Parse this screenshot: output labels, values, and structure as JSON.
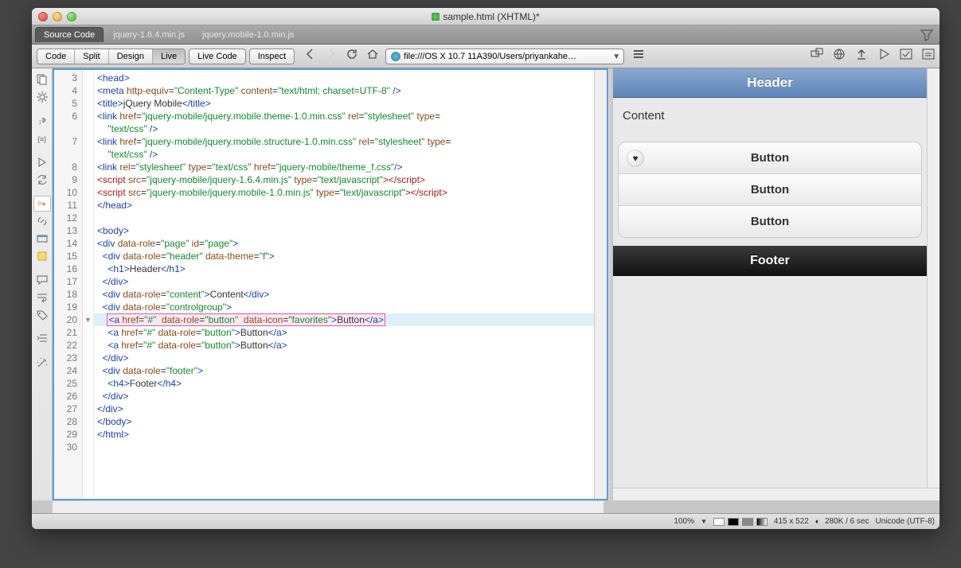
{
  "window": {
    "title": "sample.html (XHTML)*"
  },
  "tabs": {
    "items": [
      "Source Code",
      "jquery-1.6.4.min.js",
      "jquery.mobile-1.0.min.js"
    ],
    "active": 0
  },
  "toolbar": {
    "modes": [
      "Code",
      "Split",
      "Design",
      "Live"
    ],
    "active_mode": 3,
    "live_code": "Live Code",
    "inspect": "Inspect",
    "address": "file:///OS X 10.7 11A390/Users/priyankahe…"
  },
  "gutter_start": 3,
  "gutter_end": 30,
  "highlight_line": 20,
  "code_lines": [
    {
      "html": "<span class='c-blue'>&lt;head&gt;</span>"
    },
    {
      "html": "<span class='c-blue'>&lt;meta</span> <span class='c-brown'>http-equiv</span>=<span class='c-green'>\"Content-Type\"</span> <span class='c-brown'>content</span>=<span class='c-green'>\"text/html; charset=UTF-8\"</span> <span class='c-blue'>/&gt;</span>"
    },
    {
      "html": "<span class='c-blue'>&lt;title&gt;</span>jQuery Mobile<span class='c-blue'>&lt;/title&gt;</span>"
    },
    {
      "html": "<span class='c-blue'>&lt;link</span> <span class='c-brown'>href</span>=<span class='c-green'>\"jquery-mobile/jquery.mobile.theme-1.0.min.css\"</span> <span class='c-brown'>rel</span>=<span class='c-green'>\"stylesheet\"</span> <span class='c-brown'>type</span>=<br>    <span class='c-green'>\"text/css\"</span> <span class='c-blue'>/&gt;</span>",
      "rows": 2
    },
    {
      "html": "<span class='c-blue'>&lt;link</span> <span class='c-brown'>href</span>=<span class='c-green'>\"jquery-mobile/jquery.mobile.structure-1.0.min.css\"</span> <span class='c-brown'>rel</span>=<span class='c-green'>\"stylesheet\"</span> <span class='c-brown'>type</span>=<br>    <span class='c-green'>\"text/css\"</span> <span class='c-blue'>/&gt;</span>",
      "rows": 2
    },
    {
      "html": "<span class='c-blue'>&lt;link</span> <span class='c-brown'>rel</span>=<span class='c-green'>\"stylesheet\"</span> <span class='c-brown'>type</span>=<span class='c-green'>\"text/css\"</span> <span class='c-brown'>href</span>=<span class='c-green'>\"jquery-mobile/theme_f.css\"</span><span class='c-blue'>/&gt;</span>"
    },
    {
      "html": "<span class='c-red'>&lt;script</span> <span class='c-brown'>src</span>=<span class='c-green'>\"jquery-mobile/jquery-1.6.4.min.js\"</span> <span class='c-brown'>type</span>=<span class='c-green'>\"text/javascript\"</span><span class='c-red'>&gt;&lt;/script&gt;</span>"
    },
    {
      "html": "<span class='c-red'>&lt;script</span> <span class='c-brown'>src</span>=<span class='c-green'>\"jquery-mobile/jquery.mobile-1.0.min.js\"</span> <span class='c-brown'>type</span>=<span class='c-green'>\"text/javascript\"</span><span class='c-red'>&gt;&lt;/script&gt;</span>"
    },
    {
      "html": "<span class='c-blue'>&lt;/head&gt;</span>"
    },
    {
      "html": ""
    },
    {
      "html": "<span class='c-blue'>&lt;body&gt;</span>"
    },
    {
      "html": "<span class='c-blue'>&lt;div</span> <span class='c-brown'>data-role</span>=<span class='c-green'>\"page\"</span> <span class='c-brown'>id</span>=<span class='c-green'>\"page\"</span><span class='c-blue'>&gt;</span>"
    },
    {
      "html": "  <span class='c-blue'>&lt;div</span> <span class='c-brown'>data-role</span>=<span class='c-green'>\"header\"</span> <span class='c-brown'>data-theme</span>=<span class='c-green'>\"f\"</span><span class='c-blue'>&gt;</span>"
    },
    {
      "html": "    <span class='c-blue'>&lt;h1&gt;</span>Header<span class='c-blue'>&lt;/h1&gt;</span>"
    },
    {
      "html": "  <span class='c-blue'>&lt;/div&gt;</span>"
    },
    {
      "html": "  <span class='c-blue'>&lt;div</span> <span class='c-brown'>data-role</span>=<span class='c-green'>\"content\"</span><span class='c-blue'>&gt;</span>Content<span class='c-blue'>&lt;/div&gt;</span>"
    },
    {
      "html": "  <span class='c-blue'>&lt;div</span> <span class='c-brown'>data-role</span>=<span class='c-green'>\"controlgroup\"</span><span class='c-blue'>&gt;</span>"
    },
    {
      "html": "    <span class='sel'><span class='c-blue'>&lt;a</span> <span class='c-brown'>href</span>=<span class='c-green'>\"#\"</span>  <span class='c-brown'>data-role</span>=<span class='c-green'>\"button\"</span>  <span class='c-brown'>data-icon</span>=<span class='c-green'>\"favorites\"</span><span class='c-blue'>&gt;</span>Button<span class='c-blue'>&lt;/a&gt;</span></span>",
      "sel": true
    },
    {
      "html": "    <span class='c-blue'>&lt;a</span> <span class='c-brown'>href</span>=<span class='c-green'>\"#\"</span> <span class='c-brown'>data-role</span>=<span class='c-green'>\"button\"</span><span class='c-blue'>&gt;</span>Button<span class='c-blue'>&lt;/a&gt;</span>"
    },
    {
      "html": "    <span class='c-blue'>&lt;a</span> <span class='c-brown'>href</span>=<span class='c-green'>\"#\"</span> <span class='c-brown'>data-role</span>=<span class='c-green'>\"button\"</span><span class='c-blue'>&gt;</span>Button<span class='c-blue'>&lt;/a&gt;</span>"
    },
    {
      "html": "  <span class='c-blue'>&lt;/div&gt;</span>"
    },
    {
      "html": "  <span class='c-blue'>&lt;div</span> <span class='c-brown'>data-role</span>=<span class='c-green'>\"footer\"</span><span class='c-blue'>&gt;</span>"
    },
    {
      "html": "    <span class='c-blue'>&lt;h4&gt;</span>Footer<span class='c-blue'>&lt;/h4&gt;</span>"
    },
    {
      "html": "  <span class='c-blue'>&lt;/div&gt;</span>"
    },
    {
      "html": "<span class='c-blue'>&lt;/div&gt;</span>"
    },
    {
      "html": "<span class='c-blue'>&lt;/body&gt;</span>"
    },
    {
      "html": "<span class='c-blue'>&lt;/html&gt;</span>"
    },
    {
      "html": ""
    }
  ],
  "preview": {
    "header": "Header",
    "content": "Content",
    "buttons": [
      "Button",
      "Button",
      "Button"
    ],
    "footer": "Footer"
  },
  "status": {
    "zoom": "100%",
    "dims": "415 x 522",
    "load": "280K / 6 sec",
    "encoding": "Unicode (UTF-8)"
  }
}
